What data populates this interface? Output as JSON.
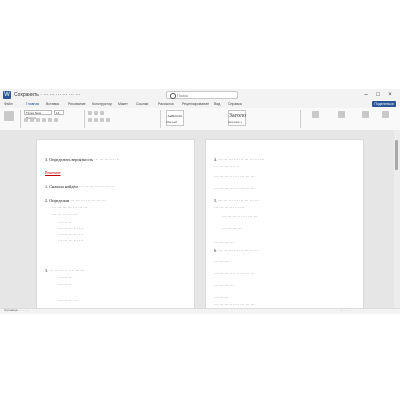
{
  "window": {
    "app_icon": "W",
    "title": "Сохранить · ··· ··· ··· ··· ··· ···",
    "search_placeholder": "Поиск"
  },
  "menu": {
    "items": [
      "Файл",
      "Главная",
      "Вставка",
      "Рисование",
      "Конструктор",
      "Макет",
      "Ссылки",
      "Рассылки",
      "Рецензирование",
      "Вид",
      "Справка"
    ],
    "active_index": 1,
    "share_label": "Поделиться"
  },
  "ribbon": {
    "font_name": "Times New Roman",
    "font_size": "14",
    "styles": [
      {
        "sample": "AaBbCcDc",
        "label": "Обычный"
      },
      {
        "sample": "Заголо",
        "label": "Заголовок 1"
      }
    ]
  },
  "document": {
    "left_page": {
      "lines": [
        {
          "text": "3.   Определить вероятность ··· ··· ··· ··· ···",
          "style": "normal"
        },
        {
          "text": "Решение",
          "style": "red"
        },
        {
          "text": "1.   Сначала найдём ··· ··· ··· ··· ··· ··· ···",
          "style": "normal"
        },
        {
          "text": "2.   Определим ··· ··· ··· ··· ··· ··· ···",
          "style": "normal"
        },
        {
          "text": "··· ··· ··· ··· ··· ··· ···",
          "style": "normal"
        },
        {
          "text": "··· ··· ··· ··· ···",
          "style": "normal"
        },
        {
          "text": "··· ··· ···",
          "style": "normal"
        },
        {
          "text": "··· ··· ··· ··· ···",
          "style": "normal"
        },
        {
          "text": "··· ··· ··· ··· ···",
          "style": "normal"
        },
        {
          "text": "··· ··· ··· ··· ···",
          "style": "normal"
        },
        {
          "text": "3.   ··· ··· ··· ··· ··· ··· ···",
          "style": "normal"
        },
        {
          "text": "··· ··· ···",
          "style": "normal"
        },
        {
          "text": "··· ··· ···",
          "style": "normal"
        },
        {
          "text": "··· ··· ··· ···",
          "style": "normal"
        }
      ]
    },
    "right_page": {
      "lines": [
        "4.   ··· ··· ··· ··· ··· ··· ··· ··· ···",
        "··· ··· ··· ··· ···",
        "··· ··· ··· ··· ··· ··· ··· ···",
        "··· ··· ··· ··· ··· ··· ··· ···",
        "5.   ··· ··· ··· ··· ··· ··· ··· ···",
        "··· ··· ··· ··· ··· ···",
        "··· ··· ··· ··· ··· ··· ···",
        "··· ··· ··· ···",
        "··· ··· ··· ···",
        "6.   ··· ··· ··· ··· ··· ··· ··· ···",
        "··· ··· ···",
        "··· ··· ··· ··· ··· ··· ··· ···",
        "··· ··· ··· ···",
        "··· ··· ···",
        "··· ··· ··· ··· ··· ··· ··· ···"
      ]
    }
  },
  "status": {
    "left": "Страница ··· ··· ···",
    "right": "··· ··· ···"
  },
  "colors": {
    "accent": "#2b579a",
    "heading_red": "#c00000"
  }
}
